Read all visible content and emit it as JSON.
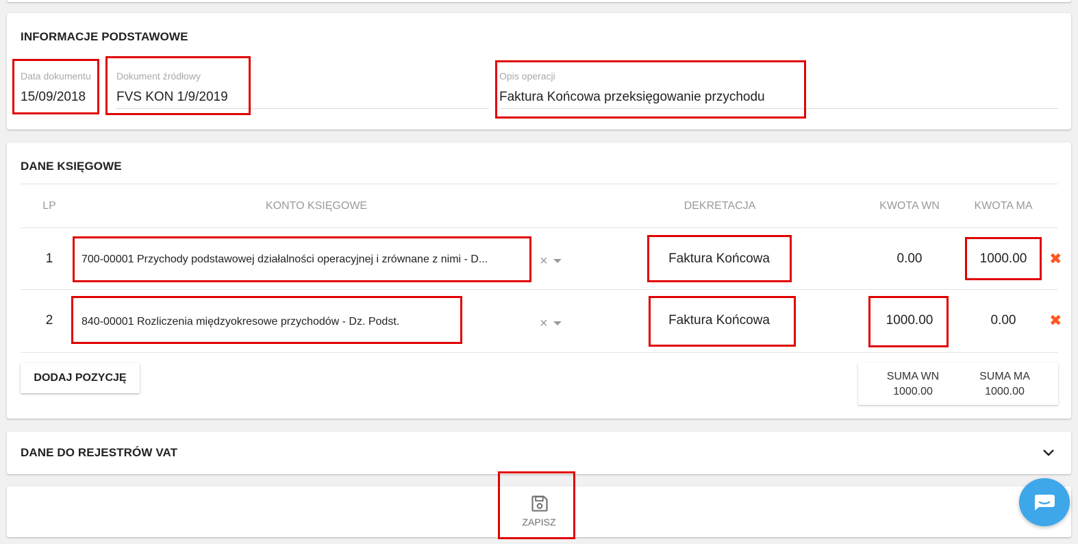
{
  "basic_info": {
    "title": "INFORMACJE PODSTAWOWE",
    "date_label": "Data dokumentu",
    "date_value": "15/09/2018",
    "source_doc_label": "Dokument źródłowy",
    "source_doc_value": "FVS KON 1/9/2019",
    "description_label": "Opis operacji",
    "description_value": "Faktura Końcowa przeksięgowanie przychodu"
  },
  "accounting": {
    "title": "DANE KSIĘGOWE",
    "columns": [
      "LP",
      "KONTO KSIĘGOWE",
      "DEKRETACJA",
      "KWOTA WN",
      "KWOTA MA"
    ],
    "rows": [
      {
        "lp": "1",
        "account": "700-00001 Przychody podstawowej działalności operacyjnej i zrównane z nimi - D...",
        "decree": "Faktura Końcowa",
        "wn": "0.00",
        "ma": "1000.00"
      },
      {
        "lp": "2",
        "account": "840-00001 Rozliczenia międzyokresowe przychodów - Dz. Podst.",
        "decree": "Faktura Końcowa",
        "wn": "1000.00",
        "ma": "0.00"
      }
    ],
    "add_button": "DODAJ POZYCJĘ",
    "sum_wn_label": "SUMA WN",
    "sum_wn_value": "1000.00",
    "sum_ma_label": "SUMA MA",
    "sum_ma_value": "1000.00"
  },
  "vat": {
    "title": "DANE DO REJESTRÓW VAT"
  },
  "save": {
    "label": "ZAPISZ"
  },
  "icons": {
    "clear": "close-icon",
    "dropdown": "chevron-down-icon",
    "delete": "delete-x-icon",
    "expand": "chevron-down-icon",
    "save": "floppy-disk-icon",
    "chat": "chat-bubble-icon"
  },
  "colors": {
    "highlight": "#e00000",
    "delete": "#ff5722",
    "chat": "#3da7ea"
  }
}
